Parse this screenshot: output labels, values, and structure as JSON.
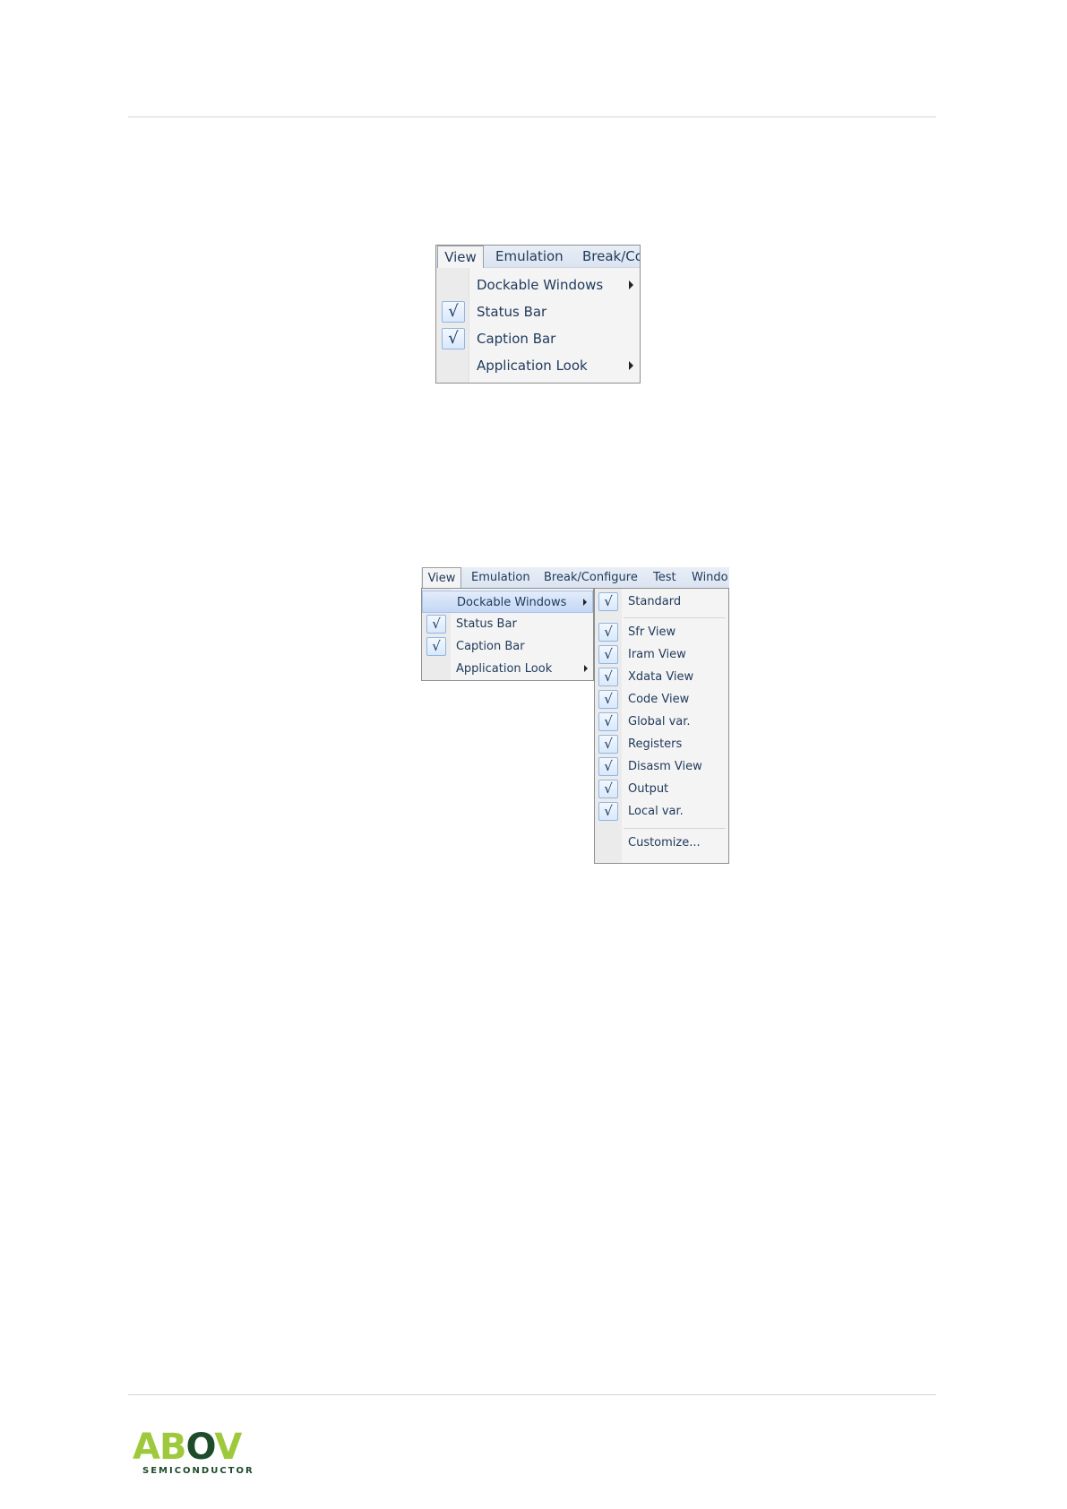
{
  "figure1": {
    "menubar": [
      "View",
      "Emulation",
      "Break/Co"
    ],
    "items": [
      {
        "label": "Dockable Windows",
        "checked": false,
        "submenu": true
      },
      {
        "label": "Status Bar",
        "checked": true,
        "submenu": false
      },
      {
        "label": "Caption Bar",
        "checked": true,
        "submenu": false
      },
      {
        "label": "Application Look",
        "checked": false,
        "submenu": true
      }
    ]
  },
  "figure2": {
    "menubar": [
      "View",
      "Emulation",
      "Break/Configure",
      "Test",
      "Windo"
    ],
    "items": [
      {
        "label": "Dockable Windows",
        "checked": false,
        "submenu": true,
        "highlighted": true
      },
      {
        "label": "Status Bar",
        "checked": true,
        "submenu": false
      },
      {
        "label": "Caption Bar",
        "checked": true,
        "submenu": false
      },
      {
        "label": "Application Look",
        "checked": false,
        "submenu": true
      }
    ],
    "submenu": {
      "standard": "Standard",
      "windows": [
        "Sfr View",
        "Iram View",
        "Xdata View",
        "Code View",
        "Global var.",
        "Registers",
        "Disasm View",
        "Output",
        "Local var."
      ],
      "customize": "Customize..."
    }
  },
  "check_glyph": "√",
  "logo": {
    "mark_green": "AB",
    "mark_dark": "O",
    "mark_green2": "V",
    "sub": "SEMICONDUCTOR"
  },
  "colors": {
    "menu_text": "#1e395b",
    "logo_green": "#9fc93c",
    "logo_dark": "#1e4b2a"
  }
}
